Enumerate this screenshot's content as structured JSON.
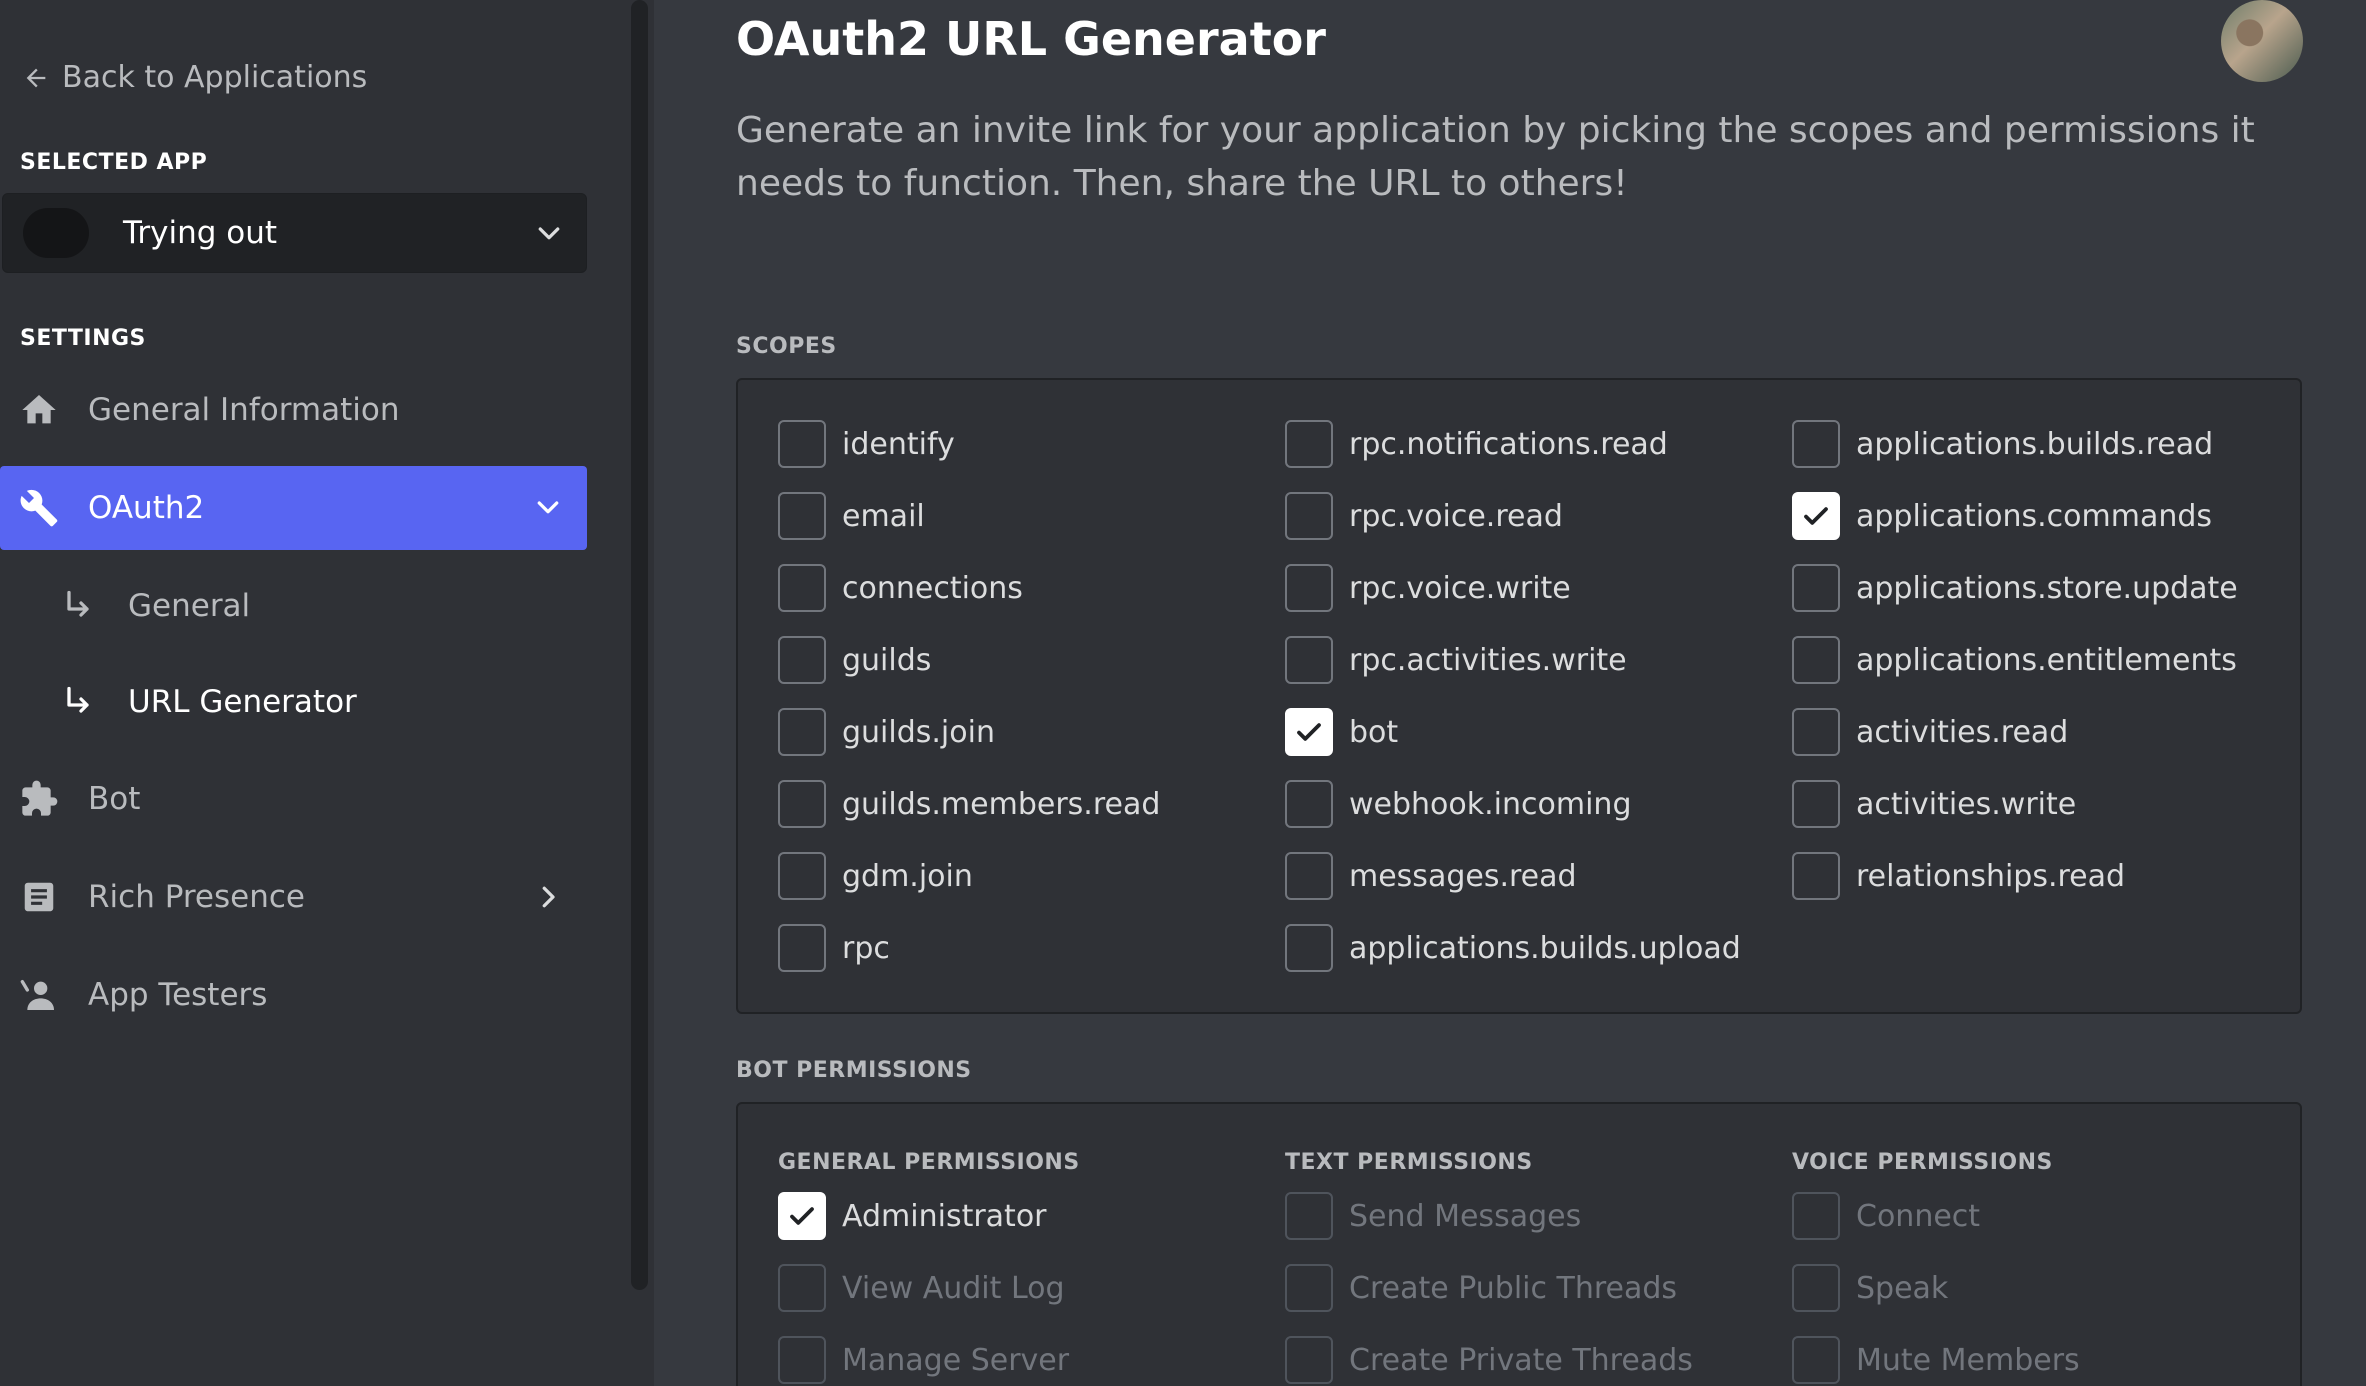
{
  "sidebar": {
    "back_label": "Back to Applications",
    "selected_app_label": "SELECTED APP",
    "selected_app_name": "Trying out",
    "settings_label": "SETTINGS",
    "items": [
      {
        "label": "General Information",
        "icon": "home-icon"
      },
      {
        "label": "OAuth2",
        "icon": "wrench-icon",
        "active": true
      },
      {
        "label": "Bot",
        "icon": "puzzle-icon"
      },
      {
        "label": "Rich Presence",
        "icon": "document-icon"
      },
      {
        "label": "App Testers",
        "icon": "user-icon"
      }
    ],
    "subitems": [
      {
        "label": "General"
      },
      {
        "label": "URL Generator",
        "current": true
      }
    ]
  },
  "main": {
    "title": "OAuth2 URL Generator",
    "description": "Generate an invite link for your application by picking the scopes and permissions it needs to function. Then, share the URL to others!",
    "scopes_label": "SCOPES",
    "scopes": [
      [
        {
          "label": "identify",
          "checked": false
        },
        {
          "label": "email",
          "checked": false
        },
        {
          "label": "connections",
          "checked": false
        },
        {
          "label": "guilds",
          "checked": false
        },
        {
          "label": "guilds.join",
          "checked": false
        },
        {
          "label": "guilds.members.read",
          "checked": false
        },
        {
          "label": "gdm.join",
          "checked": false
        },
        {
          "label": "rpc",
          "checked": false
        }
      ],
      [
        {
          "label": "rpc.notifications.read",
          "checked": false
        },
        {
          "label": "rpc.voice.read",
          "checked": false
        },
        {
          "label": "rpc.voice.write",
          "checked": false
        },
        {
          "label": "rpc.activities.write",
          "checked": false
        },
        {
          "label": "bot",
          "checked": true
        },
        {
          "label": "webhook.incoming",
          "checked": false
        },
        {
          "label": "messages.read",
          "checked": false
        },
        {
          "label": "applications.builds.upload",
          "checked": false
        }
      ],
      [
        {
          "label": "applications.builds.read",
          "checked": false
        },
        {
          "label": "applications.commands",
          "checked": true
        },
        {
          "label": "applications.store.update",
          "checked": false
        },
        {
          "label": "applications.entitlements",
          "checked": false
        },
        {
          "label": "activities.read",
          "checked": false
        },
        {
          "label": "activities.write",
          "checked": false
        },
        {
          "label": "relationships.read",
          "checked": false
        }
      ]
    ],
    "bot_permissions_label": "BOT PERMISSIONS",
    "permission_groups": [
      {
        "heading": "GENERAL PERMISSIONS",
        "items": [
          {
            "label": "Administrator",
            "checked": true,
            "disabled": false
          },
          {
            "label": "View Audit Log",
            "checked": false,
            "disabled": true
          },
          {
            "label": "Manage Server",
            "checked": false,
            "disabled": true
          }
        ]
      },
      {
        "heading": "TEXT PERMISSIONS",
        "items": [
          {
            "label": "Send Messages",
            "checked": false,
            "disabled": true
          },
          {
            "label": "Create Public Threads",
            "checked": false,
            "disabled": true
          },
          {
            "label": "Create Private Threads",
            "checked": false,
            "disabled": true
          }
        ]
      },
      {
        "heading": "VOICE PERMISSIONS",
        "items": [
          {
            "label": "Connect",
            "checked": false,
            "disabled": true
          },
          {
            "label": "Speak",
            "checked": false,
            "disabled": true
          },
          {
            "label": "Mute Members",
            "checked": false,
            "disabled": true
          }
        ]
      }
    ]
  },
  "colors": {
    "accent": "#5865f2",
    "background": "#36393f",
    "sidebar": "#2f3136"
  }
}
